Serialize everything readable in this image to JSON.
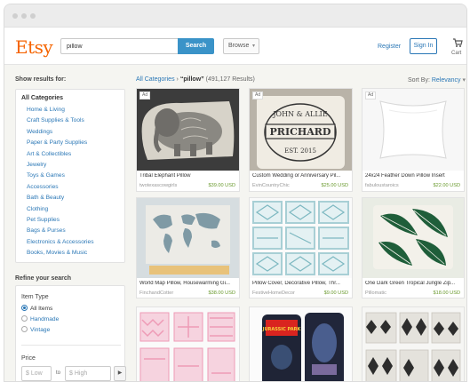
{
  "header": {
    "logo": "Etsy",
    "search_value": "pillow",
    "search_button": "Search",
    "browse_label": "Browse",
    "register": "Register",
    "sign_in": "Sign In",
    "cart": "Cart"
  },
  "sidebar": {
    "show_results": "Show results for:",
    "all_categories": "All Categories",
    "categories": [
      "Home & Living",
      "Craft Supplies & Tools",
      "Weddings",
      "Paper & Party Supplies",
      "Art & Collectibles",
      "Jewelry",
      "Toys & Games",
      "Accessories",
      "Bath & Beauty",
      "Clothing",
      "Pet Supplies",
      "Bags & Purses",
      "Electronics & Accessories",
      "Books, Movies & Music"
    ],
    "refine": "Refine your search",
    "item_type": "Item Type",
    "item_types": [
      "All Items",
      "Handmade",
      "Vintage"
    ],
    "price": "Price",
    "price_low_placeholder": "$ Low",
    "price_to": "to",
    "price_high_placeholder": "$ High"
  },
  "results": {
    "breadcrumb_link": "All Categories",
    "query": "“pillow”",
    "count": "(491,127 Results)",
    "sort_label": "Sort By:",
    "sort_value": "Relevancy"
  },
  "listings": [
    {
      "title": "Tribal Elephant Pillow",
      "shop": "twotexascowgirls",
      "price": "$39.00 USD",
      "ad": "Ad"
    },
    {
      "title": "Custom Wedding or Anniversary Pil...",
      "shop": "EvinCountryChic",
      "price": "$25.00 USD",
      "ad": "Ad"
    },
    {
      "title": "24x24 Feather Down Pillow Insert",
      "shop": "fabuloustaroics",
      "price": "$22.00 USD",
      "ad": "Ad"
    },
    {
      "title": "World Map Pillow, Housewarming Gi...",
      "shop": "FinchandCotter",
      "price": "$38.00 USD",
      "ad": ""
    },
    {
      "title": "Pillow Cover, Decorative Pillow, Thr...",
      "shop": "FestiveHomeDecor",
      "price": "$9.00 USD",
      "ad": ""
    },
    {
      "title": "One Dark Green Tropical Jungle Zip...",
      "shop": "Pillomatic",
      "price": "$18.00 USD",
      "ad": ""
    },
    {
      "title": "",
      "shop": "",
      "price": "",
      "ad": ""
    },
    {
      "title": "",
      "shop": "",
      "price": "",
      "ad": ""
    },
    {
      "title": "",
      "shop": "",
      "price": "",
      "ad": ""
    }
  ],
  "pillow_text": {
    "line1": "JOHN & ALLIE",
    "line2": "PRICHARD",
    "line3": "EST. 2015",
    "movie": "JURASSIC PARK"
  },
  "colors": {
    "brand": "#f56400",
    "link": "#2a77b6",
    "search_button": "#3a93c8",
    "price": "#6a9a2e"
  }
}
